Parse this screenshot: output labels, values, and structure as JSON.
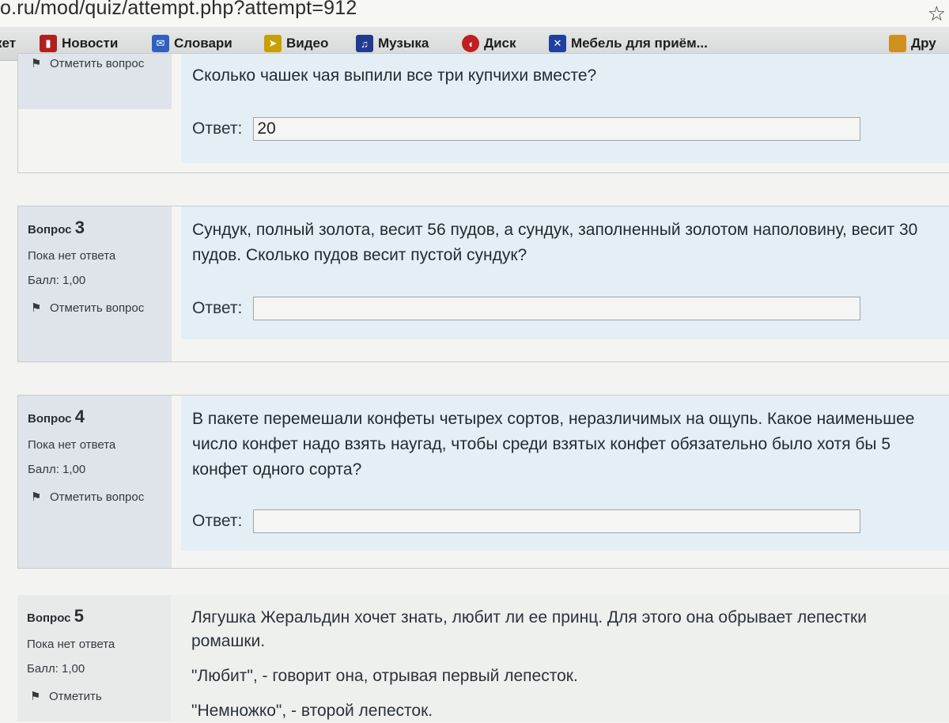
{
  "browser": {
    "url": "o.ru/mod/quiz/attempt.php?attempt=912",
    "bookmarks": [
      {
        "label": "кет",
        "icon": "none",
        "color": ""
      },
      {
        "label": "Новости",
        "icon": "news-icon",
        "color": "#b02020"
      },
      {
        "label": "Словари",
        "icon": "dictionary-icon",
        "color": "#3060c0"
      },
      {
        "label": "Видео",
        "icon": "video-icon",
        "color": "#c8a000"
      },
      {
        "label": "Музыка",
        "icon": "music-icon",
        "color": "#203a90"
      },
      {
        "label": "Диск",
        "icon": "disk-icon",
        "color": "#c02020"
      },
      {
        "label": "Мебель для приём...",
        "icon": "furniture-icon",
        "color": "#2040a0"
      },
      {
        "label": "Дру",
        "icon": "folder-icon",
        "color": "#d09020"
      }
    ]
  },
  "questions": [
    {
      "number": "",
      "state": "",
      "grade": "",
      "flag_label": "Отметить вопрос",
      "text": "Сколько чашек чая выпили все три купчихи вместе?",
      "answer_label": "Ответ:",
      "answer_value": "20"
    },
    {
      "number": "3",
      "number_prefix": "Вопрос",
      "state": "Пока нет ответа",
      "grade": "Балл: 1,00",
      "flag_label": "Отметить вопрос",
      "text": "Сундук, полный золота, весит 56 пудов, а сундук, заполненный золотом наполовину, весит 30 пудов. Сколько пудов весит пустой сундук?",
      "answer_label": "Ответ:",
      "answer_value": ""
    },
    {
      "number": "4",
      "number_prefix": "Вопрос",
      "state": "Пока нет ответа",
      "grade": "Балл: 1,00",
      "flag_label": "Отметить вопрос",
      "text": "В пакете перемешали конфеты четырех сортов, неразличимых на ощупь. Какое наименьшее число конфет надо взять наугад, чтобы среди взятых конфет обязательно было хотя бы 5 конфет одного сорта?",
      "answer_label": "Ответ:",
      "answer_value": ""
    },
    {
      "number": "5",
      "number_prefix": "Вопрос",
      "state": "Пока нет ответа",
      "grade": "Балл: 1,00",
      "flag_label": "Отметить",
      "paragraphs": [
        "Лягушка Жеральдин хочет знать, любит ли ее принц. Для этого она обрывает лепестки ромашки.",
        "\"Любит\", - говорит она, отрывая первый лепесток.",
        "\"Немножко\", - второй лепесток."
      ]
    }
  ]
}
